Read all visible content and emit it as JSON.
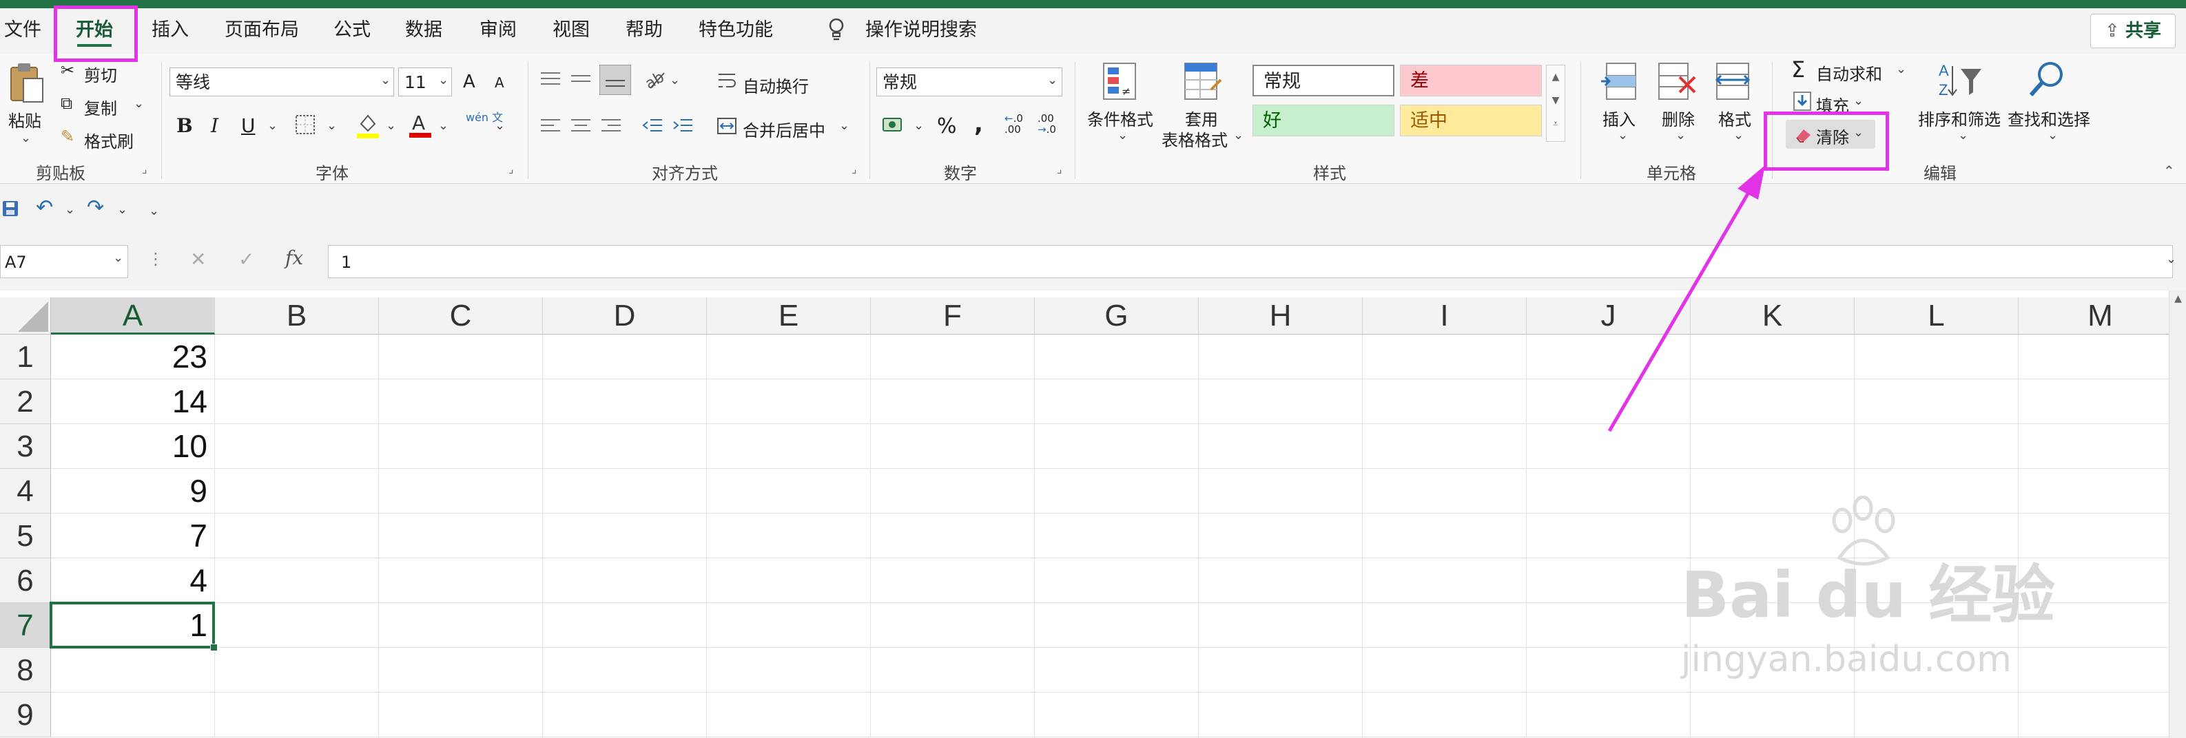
{
  "tabs": [
    "文件",
    "开始",
    "插入",
    "页面布局",
    "公式",
    "数据",
    "审阅",
    "视图",
    "帮助",
    "特色功能"
  ],
  "tell_me": "操作说明搜索",
  "share_label": "共享",
  "clipboard": {
    "paste": "粘贴",
    "cut": "剪切",
    "copy": "复制",
    "format_painter": "格式刷",
    "group": "剪贴板"
  },
  "font": {
    "name": "等线",
    "size": "11",
    "bold": "B",
    "italic": "I",
    "underline": "U",
    "grow": "A",
    "shrink": "A",
    "phonetic": "wén 文",
    "group": "字体"
  },
  "alignment": {
    "wrap": "自动换行",
    "merge": "合并后居中",
    "group": "对齐方式"
  },
  "number": {
    "format": "常规",
    "percent": "%",
    "comma": ",",
    "inc_decimal": ".00",
    "dec_decimal": ".00",
    "group": "数字"
  },
  "styles": {
    "conditional": "条件格式",
    "table_line1": "套用",
    "table_line2": "表格格式",
    "normal": "常规",
    "bad": "差",
    "good": "好",
    "neutral": "适中",
    "group": "样式"
  },
  "cells": {
    "insert": "插入",
    "delete": "删除",
    "format": "格式",
    "group": "单元格"
  },
  "editing": {
    "autosum": "自动求和",
    "fill": "填充",
    "clear": "清除",
    "sort": "排序和筛选",
    "find": "查找和选择",
    "group": "编辑"
  },
  "formula_bar": {
    "name_box": "A7",
    "fx": "fx",
    "value": "1"
  },
  "columns": [
    "A",
    "B",
    "C",
    "D",
    "E",
    "F",
    "G",
    "H",
    "I",
    "J",
    "K",
    "L",
    "M"
  ],
  "rows": [
    "1",
    "2",
    "3",
    "4",
    "5",
    "6",
    "7",
    "8",
    "9"
  ],
  "column_a_values": [
    "23",
    "14",
    "10",
    "9",
    "7",
    "4",
    "1",
    "",
    ""
  ],
  "selected_cell": "A7",
  "watermark": {
    "brand": "Bai du 经验",
    "url": "jingyan.baidu.com"
  },
  "colors": {
    "excel_green": "#217346",
    "highlight": "#e234e6",
    "bad_fill": "#ffc7ce",
    "good_fill": "#c6efce",
    "neutral_fill": "#ffeb9c"
  }
}
